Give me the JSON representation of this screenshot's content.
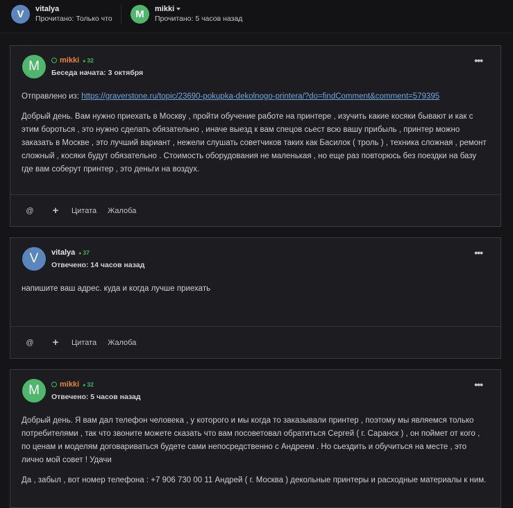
{
  "participants": [
    {
      "initial": "V",
      "name": "vitalya",
      "status": "Прочитано: Только что",
      "color": "#5a86bd"
    },
    {
      "initial": "M",
      "name": "mikki",
      "status": "Прочитано: 5 часов назад",
      "color": "#4fb76c"
    }
  ],
  "posts": [
    {
      "initial": "M",
      "author": "mikki",
      "reputation": "32",
      "date": "Беседа начата: 3 октября",
      "source_label": "Отправлено из:",
      "source_link": "https://graverstone.ru/topic/23690-pokupka-dekolnogo-printera/?do=findComment&comment=579395",
      "paragraphs": [
        "Добрый день.  Вам нужно приехать в Москву , пройти обучение работе на принтере , изучить какие косяки бывают и как с этим бороться , это нужно сделать обязательно , иначе выезд к вам спецов сьест всю вашу прибыль , принтер можно заказать в Москве , это лучший вариант , нежели слушать советчиков таких как Басилок ( троль ) ,  техника сложная , ремонт сложный , косяки будут обязательно . Стоимость оборудования не маленькая , но еще раз повторюсь без поездки на базу где вам соберут принтер , это деньги на воздух."
      ]
    },
    {
      "initial": "V",
      "author": "vitalya",
      "reputation": "37",
      "date": "Отвечено: 14 часов назад",
      "paragraphs": [
        "напишите ваш адрес. куда и когда лучше приехать"
      ]
    },
    {
      "initial": "M",
      "author": "mikki",
      "reputation": "32",
      "date": "Отвечено: 5 часов назад",
      "paragraphs": [
        "Добрый день. Я вам дал телефон человека , у которого и мы когда то заказывали принтер , поэтому мы являемся только потребителями , так что звоните  можете сказать что вам посоветовал обратиться Сергей ( г. Саранск ) , он поймет от кого , по ценам и моделям договариваться будете сами непосредственно с Андреем . Но сьездить и обучиться на месте , это лично мой совет ! Удачи",
        "Да , забыл , вот номер телефона : +7 906 730 00 11  Андрей ( г. Москва )  декольные принтеры и расходные материалы к ним."
      ]
    }
  ],
  "actions": {
    "mention_icon": "@",
    "add_icon": "+",
    "quote": "Цитата",
    "report": "Жалоба"
  },
  "menu_icon": "•••"
}
